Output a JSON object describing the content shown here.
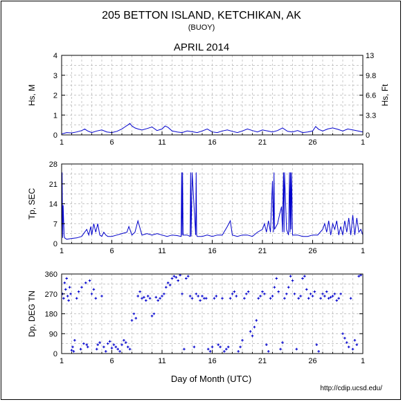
{
  "header": {
    "title": "205 BETTON ISLAND, KETCHIKAN, AK",
    "subtitle": "(BUOY)",
    "period": "APRIL 2014"
  },
  "footer": {
    "xlabel": "Day of Month (UTC)",
    "url": "http://cdip.ucsd.edu/"
  },
  "colors": {
    "series": "#0000cc",
    "grid": "#b4b4b4",
    "axis": "#000000"
  },
  "chart_data": [
    {
      "type": "line",
      "ylabel": "Hs, M",
      "ylabel_right": "Hs, Ft",
      "ylim": [
        0,
        4
      ],
      "yticks": [
        "0",
        "1",
        "2",
        "3",
        "4"
      ],
      "yticks_right": [
        "0",
        "3.3",
        "6.6",
        "9.8",
        "13"
      ],
      "xlim": [
        1,
        31
      ],
      "xticks": [
        "1",
        "6",
        "11",
        "16",
        "21",
        "26",
        "1"
      ],
      "grid": true,
      "x": [
        1,
        1.5,
        2,
        2.5,
        3,
        3.3,
        3.6,
        4,
        4.5,
        5,
        5.5,
        6,
        6.5,
        7,
        7.3,
        7.6,
        7.8,
        8,
        8.3,
        8.6,
        9,
        9.5,
        10,
        10.5,
        11,
        11.3,
        11.6,
        12,
        12.5,
        13,
        13.5,
        14,
        14.5,
        15,
        15.5,
        16,
        16.5,
        17,
        17.5,
        18,
        18.5,
        19,
        19.5,
        20,
        20.5,
        21,
        21.5,
        22,
        22.5,
        23,
        23.5,
        24,
        24.5,
        25,
        25.5,
        26,
        26.3,
        26.6,
        27,
        27.5,
        28,
        28.5,
        29,
        29.5,
        30,
        30.5,
        31
      ],
      "values": [
        0.05,
        0.12,
        0.1,
        0.15,
        0.22,
        0.3,
        0.2,
        0.12,
        0.2,
        0.25,
        0.15,
        0.12,
        0.18,
        0.3,
        0.4,
        0.5,
        0.58,
        0.45,
        0.35,
        0.3,
        0.25,
        0.32,
        0.4,
        0.22,
        0.3,
        0.45,
        0.38,
        0.2,
        0.15,
        0.12,
        0.2,
        0.16,
        0.12,
        0.2,
        0.3,
        0.15,
        0.12,
        0.2,
        0.25,
        0.18,
        0.12,
        0.2,
        0.3,
        0.22,
        0.15,
        0.25,
        0.2,
        0.15,
        0.22,
        0.35,
        0.18,
        0.15,
        0.22,
        0.12,
        0.15,
        0.2,
        0.42,
        0.28,
        0.2,
        0.3,
        0.35,
        0.28,
        0.2,
        0.3,
        0.25,
        0.2,
        0.15
      ]
    },
    {
      "type": "line",
      "ylabel": "Tp, SEC",
      "ylim": [
        0,
        28
      ],
      "yticks": [
        "0",
        "7",
        "14",
        "21",
        "28"
      ],
      "xlim": [
        1,
        31
      ],
      "xticks": [
        "1",
        "6",
        "11",
        "16",
        "21",
        "26",
        "1"
      ],
      "grid": true,
      "x": [
        1,
        1.05,
        1.1,
        1.15,
        1.2,
        1.25,
        1.3,
        1.5,
        2,
        2.5,
        3,
        3.3,
        3.5,
        3.7,
        3.9,
        4,
        4.2,
        4.4,
        4.6,
        4.8,
        5,
        5.2,
        5.4,
        5.6,
        6,
        6.5,
        7,
        7.5,
        7.7,
        8,
        8.3,
        8.6,
        9,
        9.5,
        10,
        10.5,
        11,
        11.5,
        12,
        12.5,
        12.9,
        12.95,
        13,
        13.05,
        13.1,
        13.5,
        13.8,
        13.85,
        13.9,
        14,
        14.35,
        14.4,
        14.45,
        14.5,
        15,
        15.5,
        16,
        16.5,
        17,
        17.5,
        17.8,
        18,
        18.5,
        19,
        19.5,
        20,
        20.5,
        21,
        21.2,
        21.4,
        21.6,
        21.8,
        22,
        22.1,
        22.15,
        22.2,
        22.5,
        22.7,
        22.9,
        23,
        23.1,
        23.15,
        23.2,
        23.4,
        23.6,
        23.7,
        23.75,
        23.8,
        23.85,
        23.9,
        24,
        24.5,
        25,
        25.5,
        26,
        26.5,
        27,
        27.2,
        27.4,
        27.6,
        27.8,
        28,
        28.2,
        28.4,
        28.6,
        28.8,
        29,
        29.2,
        29.4,
        29.6,
        29.8,
        30,
        30.2,
        30.4,
        30.6,
        30.8,
        31
      ],
      "values": [
        2,
        25,
        2,
        13.5,
        8,
        3,
        2,
        1.5,
        1.8,
        2,
        2.5,
        4,
        5,
        3,
        6,
        3,
        7,
        4,
        7,
        3,
        2.5,
        4,
        3,
        2.5,
        2.5,
        3,
        3.5,
        4,
        6,
        3,
        4,
        8,
        3,
        3.5,
        3,
        3.5,
        3,
        2.5,
        3,
        2.8,
        2.5,
        25,
        3,
        25,
        3,
        3,
        2.5,
        25,
        2.5,
        25,
        3,
        25,
        3,
        2.5,
        2.5,
        3,
        2.5,
        3,
        3,
        6,
        8,
        3,
        2.5,
        3,
        3,
        2.5,
        4,
        5,
        7,
        4,
        8,
        4,
        22,
        4,
        25,
        5,
        7,
        10,
        13,
        4,
        25,
        4,
        25,
        5,
        3,
        25,
        4,
        25,
        5,
        25,
        3,
        3,
        2.5,
        2.5,
        3,
        3,
        5,
        7,
        4,
        8,
        3,
        7,
        5,
        8,
        3,
        6,
        3,
        8,
        4,
        9,
        3,
        10,
        3,
        9,
        4,
        5,
        3
      ]
    },
    {
      "type": "scatter",
      "ylabel": "Dp, DEG TN",
      "ylim": [
        0,
        360
      ],
      "yticks": [
        "0",
        "90",
        "180",
        "270",
        "360"
      ],
      "xlim": [
        1,
        31
      ],
      "xticks": [
        "1",
        "6",
        "11",
        "16",
        "21",
        "26",
        "1"
      ],
      "grid": true,
      "x": [
        1.1,
        1.2,
        1.3,
        1.4,
        1.5,
        1.6,
        1.7,
        1.8,
        1.9,
        2,
        2.1,
        2.2,
        2.3,
        2.5,
        2.7,
        2.9,
        3,
        3.2,
        3.4,
        3.5,
        3.6,
        3.8,
        4,
        4.2,
        4.4,
        4.5,
        4.6,
        4.8,
        5,
        5.2,
        5.4,
        5.6,
        5.8,
        6,
        6.2,
        6.4,
        6.6,
        6.8,
        7,
        7.2,
        7.4,
        7.6,
        7.8,
        8,
        8.2,
        8.4,
        8.6,
        8.8,
        9,
        9.2,
        9.4,
        9.6,
        9.8,
        10,
        10.2,
        10.4,
        10.6,
        10.8,
        11,
        11.2,
        11.4,
        11.6,
        11.8,
        12,
        12.2,
        12.4,
        12.6,
        12.8,
        13,
        13.2,
        13.4,
        13.6,
        13.8,
        14,
        14.2,
        14.4,
        14.6,
        14.8,
        15,
        15.2,
        15.4,
        15.6,
        15.8,
        16,
        16.2,
        16.4,
        16.6,
        16.8,
        17,
        17.2,
        17.4,
        17.6,
        17.8,
        18,
        18.2,
        18.4,
        18.6,
        18.8,
        19,
        19.2,
        19.4,
        19.6,
        19.8,
        20,
        20.2,
        20.4,
        20.6,
        20.8,
        21,
        21.2,
        21.4,
        21.6,
        21.8,
        22,
        22.2,
        22.4,
        22.6,
        22.8,
        23,
        23.2,
        23.4,
        23.6,
        23.8,
        24,
        24.2,
        24.4,
        24.6,
        24.8,
        25,
        25.2,
        25.4,
        25.6,
        25.8,
        26,
        26.2,
        26.4,
        26.6,
        26.8,
        27,
        27.2,
        27.4,
        27.6,
        27.8,
        28,
        28.2,
        28.4,
        28.6,
        28.8,
        29,
        29.2,
        29.4,
        29.6,
        29.8,
        30,
        30.2,
        30.4,
        30.6,
        30.8
      ],
      "values": [
        270,
        250,
        320,
        290,
        340,
        260,
        240,
        300,
        270,
        15,
        30,
        10,
        60,
        250,
        280,
        20,
        300,
        45,
        320,
        40,
        30,
        330,
        270,
        290,
        250,
        20,
        40,
        50,
        260,
        30,
        10,
        45,
        55,
        25,
        40,
        30,
        20,
        10,
        40,
        60,
        50,
        30,
        20,
        150,
        180,
        160,
        260,
        280,
        250,
        255,
        240,
        260,
        250,
        170,
        180,
        255,
        240,
        250,
        260,
        270,
        300,
        320,
        310,
        340,
        350,
        345,
        330,
        355,
        270,
        20,
        340,
        350,
        260,
        250,
        30,
        270,
        260,
        240,
        260,
        250,
        250,
        20,
        10,
        30,
        250,
        260,
        40,
        30,
        250,
        10,
        20,
        30,
        250,
        270,
        280,
        260,
        10,
        30,
        60,
        250,
        270,
        280,
        100,
        80,
        120,
        150,
        250,
        260,
        280,
        270,
        40,
        10,
        250,
        260,
        300,
        340,
        280,
        20,
        50,
        250,
        270,
        300,
        350,
        330,
        270,
        20,
        250,
        260,
        340,
        350,
        290,
        250,
        270,
        260,
        280,
        40,
        10,
        250,
        270,
        260,
        280,
        250,
        255,
        260,
        270,
        240,
        250,
        270,
        90,
        70,
        50,
        30,
        250,
        20,
        60,
        40,
        350,
        355,
        30,
        10,
        350,
        355
      ]
    }
  ]
}
